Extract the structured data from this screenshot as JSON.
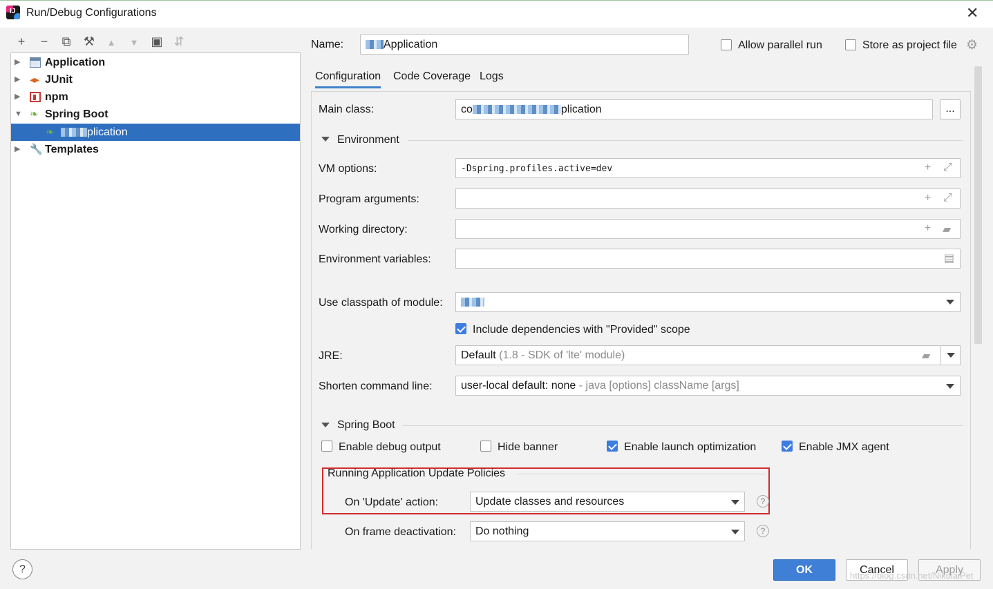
{
  "window": {
    "title": "Run/Debug Configurations"
  },
  "toolbar": {
    "add": "+",
    "remove": "−",
    "copy": "⧉",
    "edit": "⚒",
    "up": "▲",
    "down": "▼",
    "folder": "▣",
    "sort": "⇵"
  },
  "tree": {
    "items": [
      {
        "label": "Application",
        "icon": "application-icon",
        "expanded": false
      },
      {
        "label": "JUnit",
        "icon": "junit-icon",
        "expanded": false
      },
      {
        "label": "npm",
        "icon": "npm-icon",
        "expanded": false
      },
      {
        "label": "Spring Boot",
        "icon": "spring-boot-icon",
        "expanded": true
      },
      {
        "label": "plication",
        "icon": "spring-app-icon",
        "selected": true
      },
      {
        "label": "Templates",
        "icon": "wrench-icon",
        "expanded": false
      }
    ]
  },
  "name": {
    "label": "Name:",
    "value": "Application",
    "allow_parallel_run": {
      "label": "Allow parallel run",
      "checked": false
    },
    "store_as_project_file": {
      "label": "Store as project file",
      "checked": false
    }
  },
  "tabs": [
    {
      "label": "Configuration",
      "active": true
    },
    {
      "label": "Code Coverage",
      "active": false
    },
    {
      "label": "Logs",
      "active": false
    }
  ],
  "config": {
    "main_class": {
      "label": "Main class:",
      "value_prefix": "co",
      "value_suffix": "plication",
      "browse": "..."
    },
    "environment_section": "Environment",
    "vm_options": {
      "label": "VM options:",
      "value": "-Dspring.profiles.active=dev"
    },
    "program_arguments": {
      "label": "Program arguments:",
      "value": ""
    },
    "working_directory": {
      "label": "Working directory:",
      "value": ""
    },
    "environment_variables": {
      "label": "Environment variables:",
      "value": ""
    },
    "classpath_module": {
      "label": "Use classpath of module:",
      "value": ""
    },
    "include_provided": {
      "label": "Include dependencies with \"Provided\" scope",
      "checked": true
    },
    "jre": {
      "label": "JRE:",
      "value": "Default",
      "hint": "(1.8 - SDK of 'lte' module)"
    },
    "shorten_cmd": {
      "label": "Shorten command line:",
      "value": "user-local default: none",
      "hint": "- java [options] className [args]"
    },
    "spring_boot_section": "Spring Boot",
    "enable_debug_output": {
      "label": "Enable debug output",
      "checked": false
    },
    "hide_banner": {
      "label": "Hide banner",
      "checked": false
    },
    "enable_launch_opt": {
      "label": "Enable launch optimization",
      "checked": true
    },
    "enable_jmx": {
      "label": "Enable JMX agent",
      "checked": true
    },
    "update_policies_title": "Running Application Update Policies",
    "on_update": {
      "label": "On 'Update' action:",
      "value": "Update classes and resources"
    },
    "on_frame_deactivation": {
      "label": "On frame deactivation:",
      "value": "Do nothing"
    }
  },
  "buttons": {
    "help": "?",
    "ok": "OK",
    "cancel": "Cancel",
    "apply": "Apply"
  },
  "watermark": "https://blog.csdn.net/NikolaiPet",
  "colors": {
    "accent": "#3f7fd6",
    "selection": "#2f6fc0",
    "highlight_box": "#d42b2b"
  }
}
